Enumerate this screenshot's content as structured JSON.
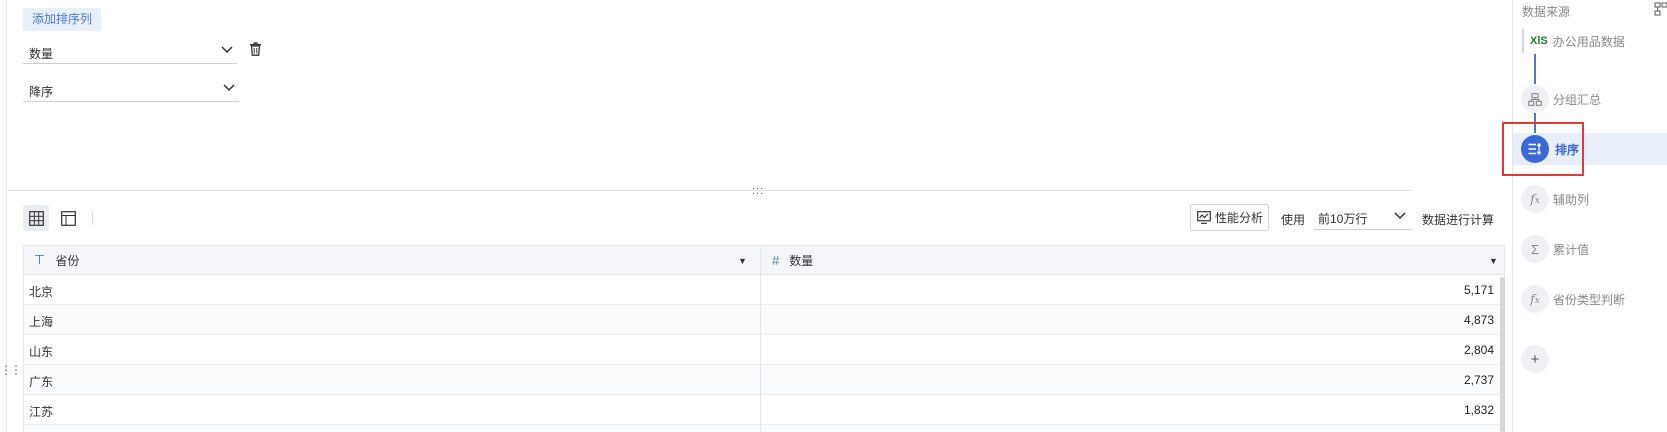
{
  "config": {
    "add_sort_button": "添加排序列",
    "sort_field": "数量",
    "sort_order": "降序"
  },
  "toolbar": {
    "perf_button": "性能分析",
    "use_label": "使用",
    "rows_option": "前10万行",
    "calc_label": "数据进行计算"
  },
  "table": {
    "columns": [
      {
        "label": "省份",
        "type_icon": "text-type-icon"
      },
      {
        "label": "数量",
        "type_icon": "number-type-icon"
      }
    ],
    "rows": [
      {
        "province": "北京",
        "qty": "5,171"
      },
      {
        "province": "上海",
        "qty": "4,873"
      },
      {
        "province": "山东",
        "qty": "2,804"
      },
      {
        "province": "广东",
        "qty": "2,737"
      },
      {
        "province": "江苏",
        "qty": "1,832"
      }
    ]
  },
  "pipeline": {
    "title": "数据来源",
    "source": "办公用品数据",
    "source_icon": "XlS",
    "steps": [
      {
        "label": "分组汇总",
        "icon": "group-icon"
      },
      {
        "label": "排序",
        "icon": "sort-icon",
        "active": true
      },
      {
        "label": "辅助列",
        "icon": "fx-icon"
      },
      {
        "label": "累计值",
        "icon": "sigma-icon"
      },
      {
        "label": "省份类型判断",
        "icon": "fx-icon"
      }
    ],
    "add_step": "+"
  },
  "colors": {
    "accent": "#3a68d8",
    "highlight": "#e53935",
    "active_bg": "#e9eefb"
  }
}
